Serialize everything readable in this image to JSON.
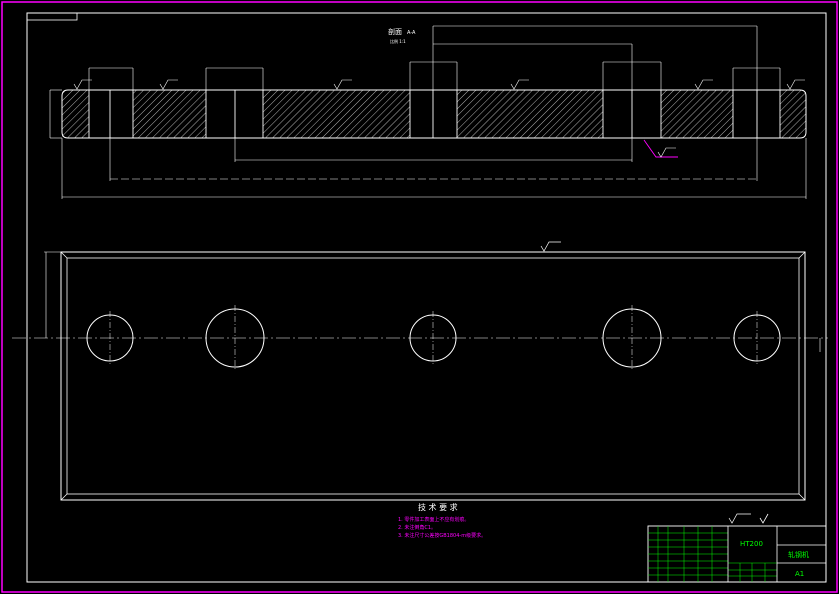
{
  "drawing": {
    "section_label": "剖面",
    "section_sub": "A-A",
    "scale_label": "比例 1:1",
    "roughness_label": "Ra6.3",
    "roughness_main": "Ra12.5",
    "tech_title": "技 术 要 求",
    "tech_notes": [
      "1. 零件加工表面上不应有划痕。",
      "2. 未注倒角C1。",
      "3. 未注尺寸公差按GB1804-m级要求。"
    ],
    "material": "HT200",
    "part_name": "轧钢机",
    "sheet": "A1"
  },
  "colors": {
    "background": "#000000",
    "line": "#ffffff",
    "frame": "#ff00ff",
    "titleblock": "#00ff00",
    "note_text": "#ff00ff"
  }
}
